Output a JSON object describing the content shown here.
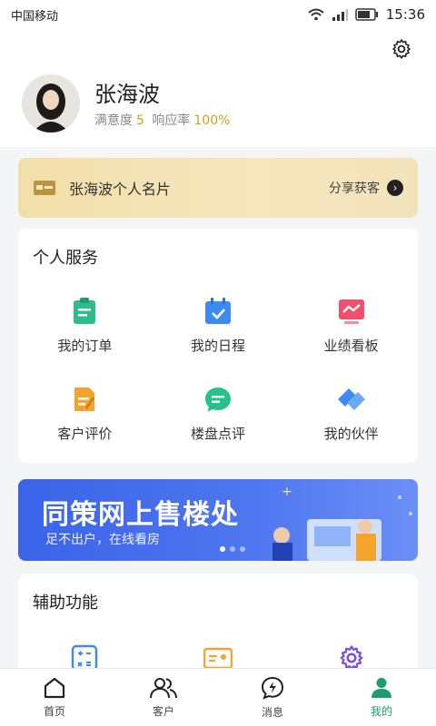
{
  "status_bar": {
    "carrier": "中国移动",
    "time": "15:36"
  },
  "profile": {
    "name": "张海波",
    "satisfaction_label": "满意度",
    "satisfaction_value": "5",
    "response_label": "响应率",
    "response_value": "100%"
  },
  "business_card": {
    "title": "张海波个人名片",
    "share_label": "分享获客"
  },
  "personal_services": {
    "title": "个人服务",
    "items": [
      {
        "label": "我的订单",
        "icon": "order-icon"
      },
      {
        "label": "我的日程",
        "icon": "calendar-icon"
      },
      {
        "label": "业绩看板",
        "icon": "performance-board-icon"
      },
      {
        "label": "客户评价",
        "icon": "review-icon"
      },
      {
        "label": "楼盘点评",
        "icon": "chat-bubble-icon"
      },
      {
        "label": "我的伙伴",
        "icon": "handshake-icon"
      }
    ]
  },
  "promo_banner": {
    "headline": "同策网上售楼处",
    "subline": "足不出户，在线看房",
    "active_slide": 1,
    "slide_count": 3
  },
  "assist_functions": {
    "title": "辅助功能",
    "items": [
      {
        "icon": "calculator-icon"
      },
      {
        "icon": "id-card-icon"
      },
      {
        "icon": "gear-icon"
      }
    ]
  },
  "bottom_nav": {
    "items": [
      {
        "label": "首页",
        "icon": "home-icon"
      },
      {
        "label": "客户",
        "icon": "customers-icon"
      },
      {
        "label": "消息",
        "icon": "message-icon"
      },
      {
        "label": "我的",
        "icon": "me-icon"
      }
    ],
    "active_index": 3
  },
  "colors": {
    "accent": "#1a9e6f",
    "gold": "#d4a017",
    "promo_blue": "#3b63e8"
  }
}
